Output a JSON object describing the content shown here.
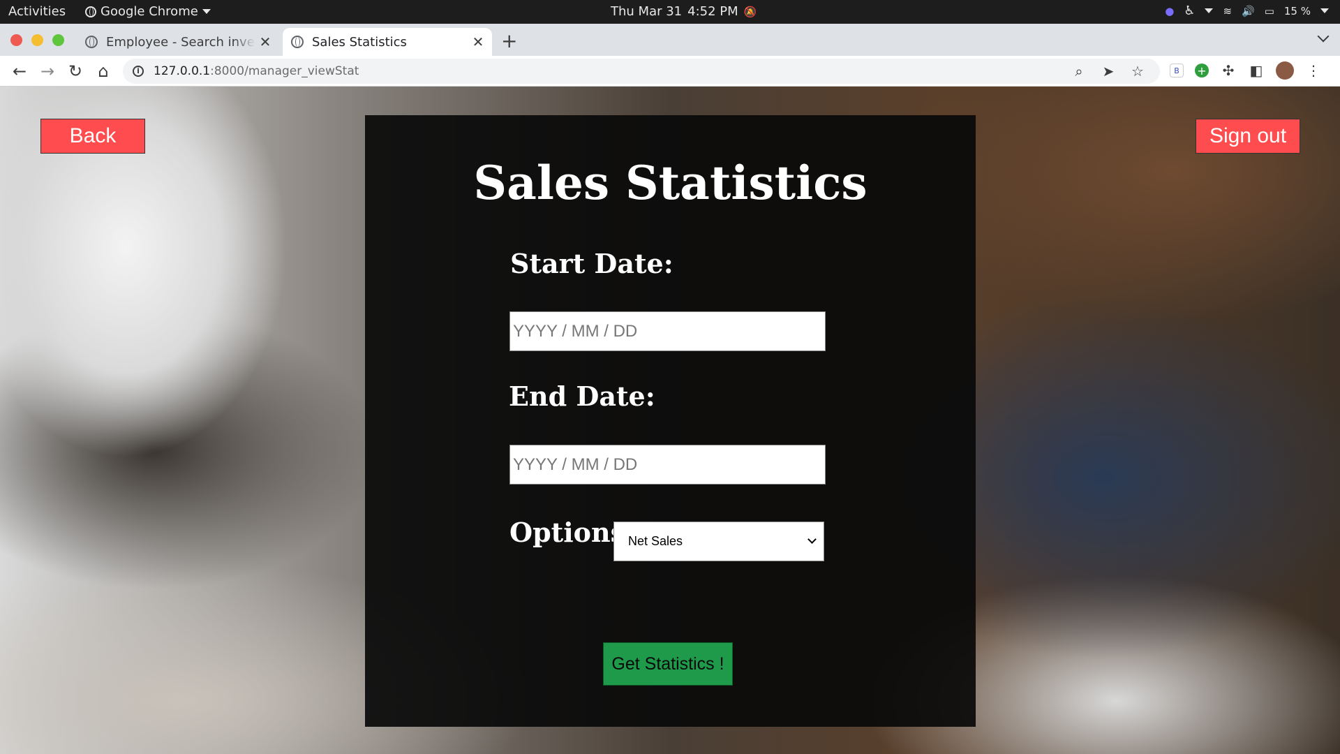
{
  "system_bar": {
    "activities": "Activities",
    "app_name": "Google Chrome",
    "date": "Thu Mar 31",
    "time": "4:52 PM",
    "battery": "15 %"
  },
  "browser": {
    "tabs": [
      {
        "title": "Employee - Search inventory",
        "active": false
      },
      {
        "title": "Sales Statistics",
        "active": true
      }
    ],
    "url_host": "127.0.0.1",
    "url_path": ":8000/manager_viewStat",
    "extension_badge": "B"
  },
  "page": {
    "title": "Sales Statistics",
    "back_label": "Back",
    "signout_label": "Sign out",
    "start_label": "Start Date:",
    "start_placeholder": "YYYY / MM / DD",
    "end_label": "End Date:",
    "end_placeholder": "YYYY / MM / DD",
    "options_label": "Options:",
    "options_selected": "Net Sales",
    "submit_label": "Get Statistics !"
  },
  "colors": {
    "danger_button": "#ff4d4f",
    "submit_button": "#1e9a4a",
    "card": "#0a0a0a"
  }
}
